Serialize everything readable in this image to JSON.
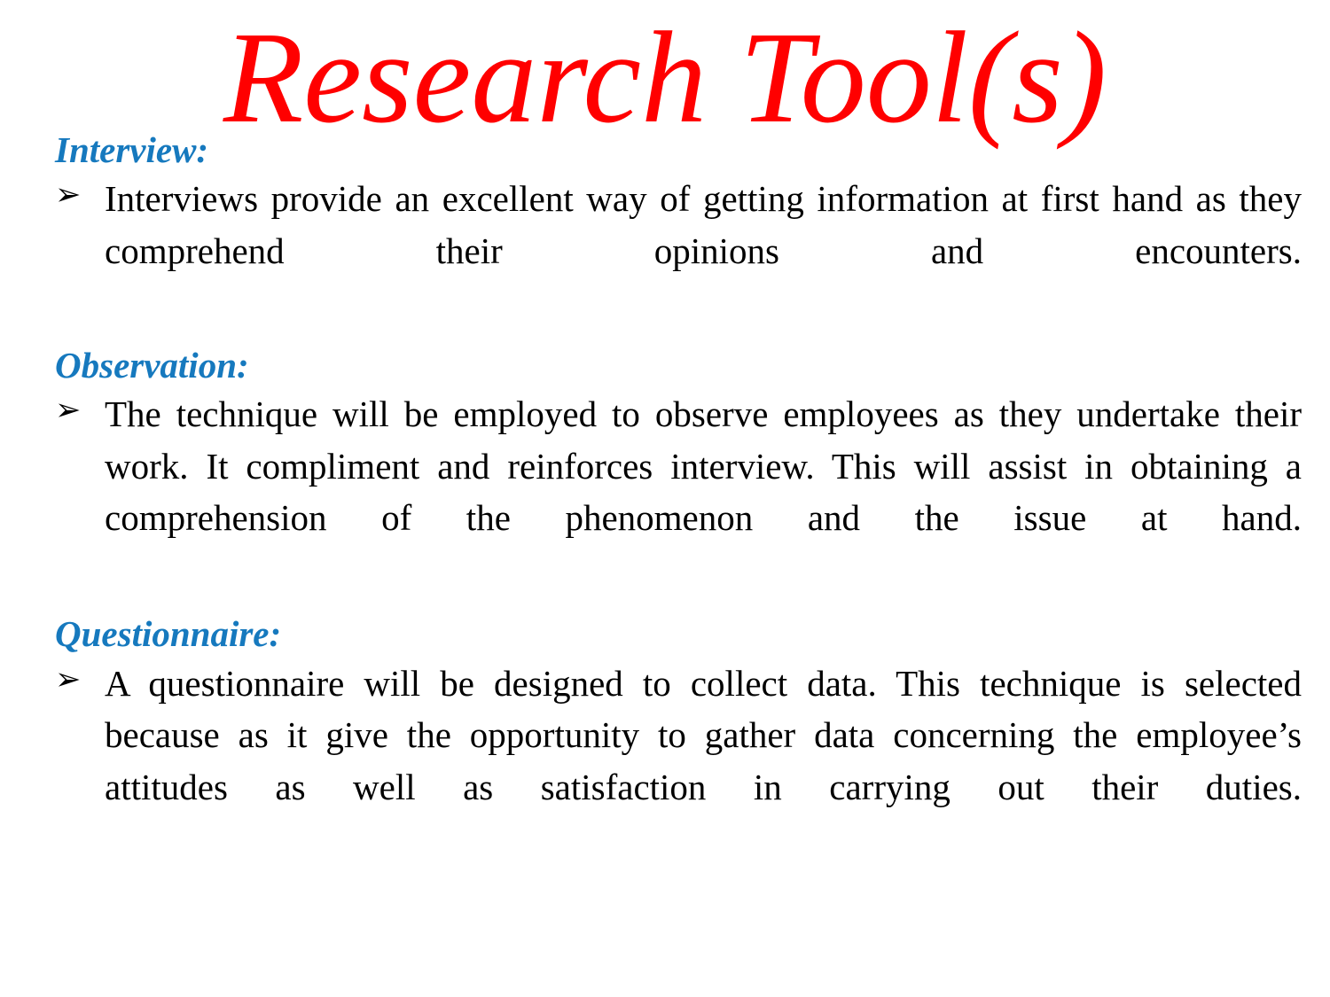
{
  "slide": {
    "title": "Research Tool(s)",
    "title_color": "#FF0000",
    "heading_color": "#1679BE",
    "body_color": "#000000",
    "background_color": "#FFFFFF",
    "bullet_glyph": "➢",
    "bullet_glyph_name": "arrowhead-bullet-icon",
    "sections": [
      {
        "heading": "Interview:",
        "bullets": [
          "Interviews provide an excellent way of getting information at first hand as they comprehend their opinions and encounters."
        ]
      },
      {
        "heading": "Observation:",
        "bullets": [
          "The technique will be employed to observe employees as they undertake their work. It compliment and reinforces interview. This will assist in obtaining a comprehension of the phenomenon and the issue at hand."
        ]
      },
      {
        "heading": "Questionnaire:",
        "bullets": [
          "A questionnaire will be designed to collect data. This technique is selected because as it give the opportunity to gather data concerning the employee’s attitudes as well as satisfaction in carrying out their duties."
        ]
      }
    ]
  }
}
